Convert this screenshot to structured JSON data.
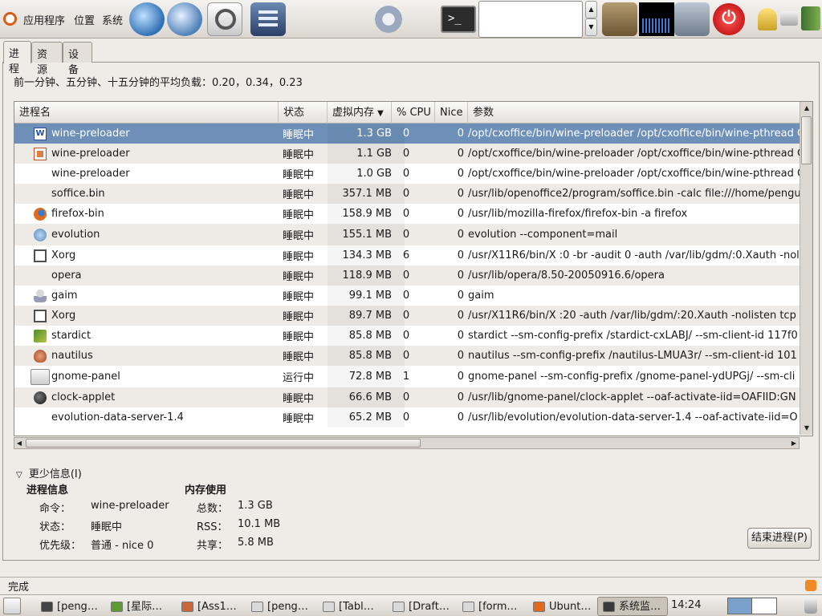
{
  "top_panel": {
    "menus": [
      "应用程序",
      "位置",
      "系统"
    ],
    "launchers": [
      "web-browser-icon",
      "mail-icon",
      "search-icon",
      "office-icon",
      "preferences-icon",
      "terminal-icon",
      "file-drawer-icon",
      "system-monitor-icon",
      "network-icon",
      "power-icon",
      "user-icon",
      "printer-icon",
      "dictionary-icon"
    ],
    "run_box_value": ""
  },
  "tabs": [
    {
      "label": "进程",
      "active": true
    },
    {
      "label": "资源",
      "active": false
    },
    {
      "label": "设备",
      "active": false
    }
  ],
  "load_average": "前一分钟、五分钟、十五分钟的平均负载：0.20，0.34，0.23",
  "table": {
    "columns": {
      "name": "进程名",
      "status": "状态",
      "memory": "虚拟内存",
      "cpu": "% CPU",
      "nice": "Nice",
      "args": "参数"
    },
    "sort_column": "memory",
    "rows": [
      {
        "icon": "writer-icon",
        "name": "wine-preloader",
        "status": "睡眠中",
        "memory": "1.3 GB",
        "cpu": "0",
        "nice": "0",
        "args": "/opt/cxoffice/bin/wine-preloader /opt/cxoffice/bin/wine-pthread C",
        "selected": true
      },
      {
        "icon": "impress-icon",
        "name": "wine-preloader",
        "status": "睡眠中",
        "memory": "1.1 GB",
        "cpu": "0",
        "nice": "0",
        "args": "/opt/cxoffice/bin/wine-preloader /opt/cxoffice/bin/wine-pthread C"
      },
      {
        "icon": "",
        "name": "wine-preloader",
        "status": "睡眠中",
        "memory": "1.0 GB",
        "cpu": "0",
        "nice": "0",
        "args": "/opt/cxoffice/bin/wine-preloader /opt/cxoffice/bin/wine-pthread C"
      },
      {
        "icon": "",
        "name": "soffice.bin",
        "status": "睡眠中",
        "memory": "357.1 MB",
        "cpu": "0",
        "nice": "0",
        "args": "/usr/lib/openoffice2/program/soffice.bin -calc file:///home/pengu"
      },
      {
        "icon": "firefox-icon",
        "name": "firefox-bin",
        "status": "睡眠中",
        "memory": "158.9 MB",
        "cpu": "0",
        "nice": "0",
        "args": "/usr/lib/mozilla-firefox/firefox-bin -a firefox"
      },
      {
        "icon": "evolution-icon",
        "name": "evolution",
        "status": "睡眠中",
        "memory": "155.1 MB",
        "cpu": "0",
        "nice": "0",
        "args": "evolution --component=mail"
      },
      {
        "icon": "xorg-icon",
        "name": "Xorg",
        "status": "睡眠中",
        "memory": "134.3 MB",
        "cpu": "6",
        "nice": "0",
        "args": "/usr/X11R6/bin/X :0 -br -audit 0 -auth /var/lib/gdm/:0.Xauth -nolis"
      },
      {
        "icon": "",
        "name": "opera",
        "status": "睡眠中",
        "memory": "118.9 MB",
        "cpu": "0",
        "nice": "0",
        "args": "/usr/lib/opera/8.50-20050916.6/opera"
      },
      {
        "icon": "gaim-icon",
        "name": "gaim",
        "status": "睡眠中",
        "memory": "99.1 MB",
        "cpu": "0",
        "nice": "0",
        "args": "gaim"
      },
      {
        "icon": "xorg-icon",
        "name": "Xorg",
        "status": "睡眠中",
        "memory": "89.7 MB",
        "cpu": "0",
        "nice": "0",
        "args": "/usr/X11R6/bin/X :20 -auth /var/lib/gdm/:20.Xauth -nolisten tcp v"
      },
      {
        "icon": "stardict-icon",
        "name": "stardict",
        "status": "睡眠中",
        "memory": "85.8 MB",
        "cpu": "0",
        "nice": "0",
        "args": "stardict --sm-config-prefix /stardict-cxLABJ/ --sm-client-id 117f0"
      },
      {
        "icon": "nautilus-icon",
        "name": "nautilus",
        "status": "睡眠中",
        "memory": "85.8 MB",
        "cpu": "0",
        "nice": "0",
        "args": "nautilus --sm-config-prefix /nautilus-LMUA3r/ --sm-client-id 101"
      },
      {
        "icon": "panel-icon",
        "name": "gnome-panel",
        "status": "运行中",
        "memory": "72.8 MB",
        "cpu": "1",
        "nice": "0",
        "args": "gnome-panel --sm-config-prefix /gnome-panel-ydUPGj/ --sm-cli"
      },
      {
        "icon": "clock-icon",
        "name": "clock-applet",
        "status": "睡眠中",
        "memory": "66.6 MB",
        "cpu": "0",
        "nice": "0",
        "args": "/usr/lib/gnome-panel/clock-applet --oaf-activate-iid=OAFIID:GN"
      },
      {
        "icon": "",
        "name": "evolution-data-server-1.4",
        "status": "睡眠中",
        "memory": "65.2 MB",
        "cpu": "0",
        "nice": "0",
        "args": "/usr/lib/evolution/evolution-data-server-1.4 --oaf-activate-iid=O"
      }
    ]
  },
  "details": {
    "toggle_label": "更少信息(I)",
    "process_info": {
      "heading": "进程信息",
      "command_label": "命令：",
      "command_value": "wine-preloader",
      "status_label": "状态：",
      "status_value": "睡眠中",
      "priority_label": "优先级：",
      "priority_value": "普通 - nice 0"
    },
    "memory_usage": {
      "heading": "内存使用",
      "total_label": "总数：",
      "total_value": "1.3 GB",
      "rss_label": "RSS：",
      "rss_value": "10.1 MB",
      "shared_label": "共享：",
      "shared_value": "5.8 MB"
    },
    "end_process_label": "结束进程(P)"
  },
  "status_bar": {
    "text": "完成"
  },
  "taskbar": {
    "tasks": [
      {
        "label": "[peng…",
        "icon": "terminal-icon",
        "active": false
      },
      {
        "label": "[星际…",
        "icon": "stardict-icon",
        "active": false
      },
      {
        "label": "[Ass1…",
        "icon": "impress-icon",
        "active": false
      },
      {
        "label": "[peng…",
        "icon": "document-icon",
        "active": false
      },
      {
        "label": "[Tabl…",
        "icon": "document-icon",
        "active": false
      },
      {
        "label": "[Draft…",
        "icon": "document-icon",
        "active": false
      },
      {
        "label": "[form…",
        "icon": "document-icon",
        "active": false
      },
      {
        "label": "Ubunt…",
        "icon": "firefox-icon",
        "active": false
      },
      {
        "label": "系统监…",
        "icon": "system-monitor-icon",
        "active": true
      }
    ],
    "clock": "14:24"
  },
  "colors": {
    "selection": "#6d8fb8",
    "panel": "#efebe7",
    "alt_row": "#eeeae5"
  }
}
